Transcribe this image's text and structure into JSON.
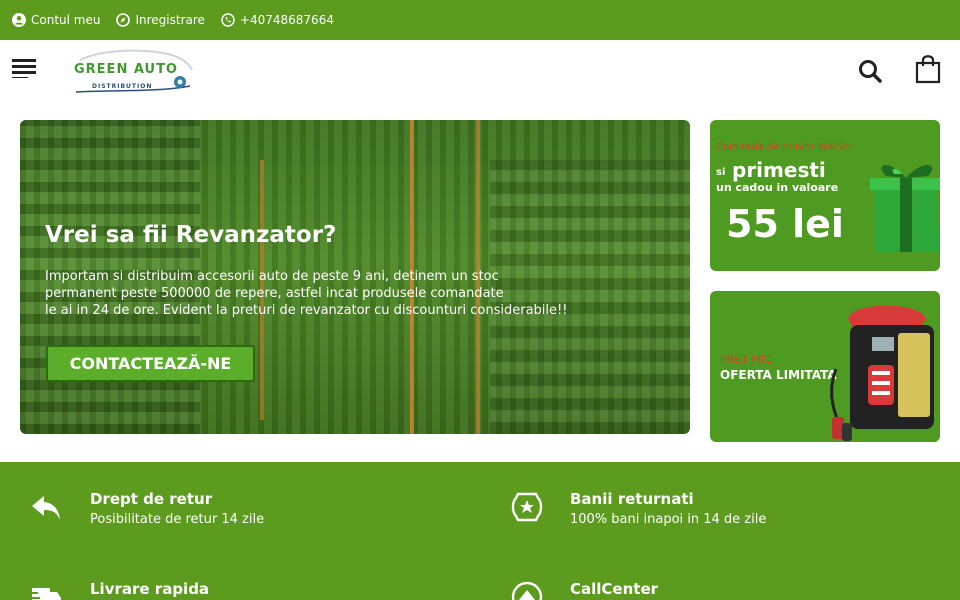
{
  "topbar": {
    "account": "Contul meu",
    "register": "Inregistrare",
    "phone": "+40748687664"
  },
  "header": {
    "logo_text": "GREEN AUTO",
    "logo_sub": "DISTRIBUTION"
  },
  "hero": {
    "title": "Vrei sa fii Revanzator?",
    "line1": "Importam si distribuim accesorii auto de peste 9 ani, detinem un stoc",
    "line2": "permanent peste 500000 de repere, astfel incat produsele comandate",
    "line3": "le ai in 24 de ore. Evident la preturi de revanzator cu discounturi considerabile!!",
    "cta": "CONTACTEAZĂ-NE"
  },
  "banner_gift": {
    "small": "Comanda de minim 300 lei",
    "si": "si",
    "big": "primesti",
    "mid": "un cadou in valoare",
    "price": "55 lei"
  },
  "banner_offer": {
    "small": "PRET MIC",
    "big": "OFERTA LIMITATA"
  },
  "features": [
    {
      "icon": "return-arrow-icon",
      "title": "Drept de retur",
      "subtitle": "Posibilitate de retur 14 zile"
    },
    {
      "icon": "shield-star-icon",
      "title": "Banii returnati",
      "subtitle": "100% bani inapoi in 14 de zile"
    },
    {
      "icon": "truck-icon",
      "title": "Livrare rapida",
      "subtitle": ""
    },
    {
      "icon": "headset-icon",
      "title": "CallCenter",
      "subtitle": ""
    }
  ],
  "colors": {
    "brand_green": "#5c9b1e",
    "cta_green": "#5cae2a",
    "promo_red": "#e33a1f"
  }
}
